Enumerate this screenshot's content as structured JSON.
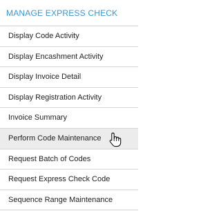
{
  "menu": {
    "header": "MANAGE EXPRESS CHECK",
    "items": [
      {
        "label": "Display Code Activity"
      },
      {
        "label": "Display Encashment Activity"
      },
      {
        "label": "Display Invoice Detail"
      },
      {
        "label": "Display Registration Activity"
      },
      {
        "label": "Invoice Summary"
      },
      {
        "label": "Perform Code Maintenance",
        "hovered": true
      },
      {
        "label": "Request Batch of Codes"
      },
      {
        "label": "Request Express Check Code"
      },
      {
        "label": "Sequence Range Maintenance"
      }
    ]
  },
  "colors": {
    "header_text": "#3c96d2",
    "item_text": "#222222",
    "hover_bg": "#ececec",
    "divider": "#d4d4d4"
  },
  "icons": {
    "cursor": "hand-pointer-icon"
  }
}
